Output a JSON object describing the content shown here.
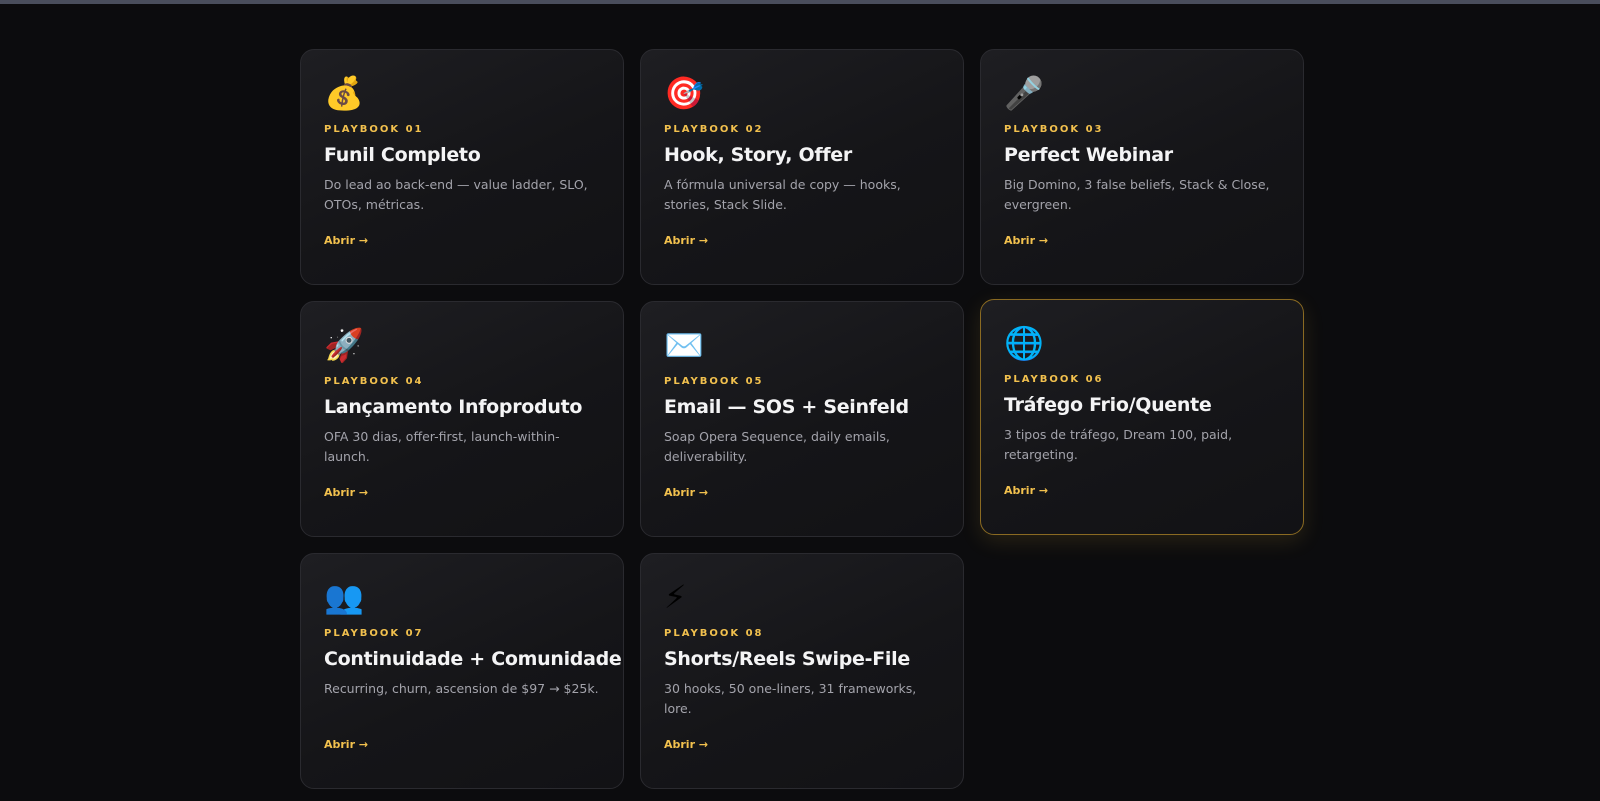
{
  "cards": [
    {
      "icon": "money-bag-icon",
      "glyph": "💰",
      "label": "PLAYBOOK 01",
      "title": "Funil Completo",
      "description": "Do lead ao back-end — value ladder, SLO, OTOs, métricas.",
      "link": "Abrir →"
    },
    {
      "icon": "target-icon",
      "glyph": "🎯",
      "label": "PLAYBOOK 02",
      "title": "Hook, Story, Offer",
      "description": "A fórmula universal de copy — hooks, stories, Stack Slide.",
      "link": "Abrir →"
    },
    {
      "icon": "microphone-icon",
      "glyph": "🎤",
      "label": "PLAYBOOK 03",
      "title": "Perfect Webinar",
      "description": "Big Domino, 3 false beliefs, Stack & Close, evergreen.",
      "link": "Abrir →"
    },
    {
      "icon": "rocket-icon",
      "glyph": "🚀",
      "label": "PLAYBOOK 04",
      "title": "Lançamento Infoproduto",
      "description": "OFA 30 dias, offer-first, launch-within-launch.",
      "link": "Abrir →"
    },
    {
      "icon": "envelope-icon",
      "glyph": "✉️",
      "label": "PLAYBOOK 05",
      "title": "Email — SOS + Seinfeld",
      "description": "Soap Opera Sequence, daily emails, deliverability.",
      "link": "Abrir →"
    },
    {
      "icon": "globe-icon",
      "glyph": "🌐",
      "label": "PLAYBOOK 06",
      "title": "Tráfego Frio/Quente",
      "description": "3 tipos de tráfego, Dream 100, paid, retargeting.",
      "link": "Abrir →"
    },
    {
      "icon": "people-icon",
      "glyph": "👥",
      "label": "PLAYBOOK 07",
      "title": "Continuidade + Comunidade",
      "description": "Recurring, churn, ascension de $97 → $25k.",
      "link": "Abrir →"
    },
    {
      "icon": "lightning-icon",
      "glyph": "⚡",
      "label": "PLAYBOOK 08",
      "title": "Shorts/Reels Swipe-File",
      "description": "30 hooks, 50 one-liners, 31 frameworks, lore.",
      "link": "Abrir →"
    }
  ],
  "colors": {
    "accent": "#f2c14e",
    "background": "#0c0c0e",
    "card_border": "#2a2a2f",
    "card_highlight_border": "#8a6a22",
    "title": "#f4f4f5",
    "description": "#a3a3ab"
  }
}
